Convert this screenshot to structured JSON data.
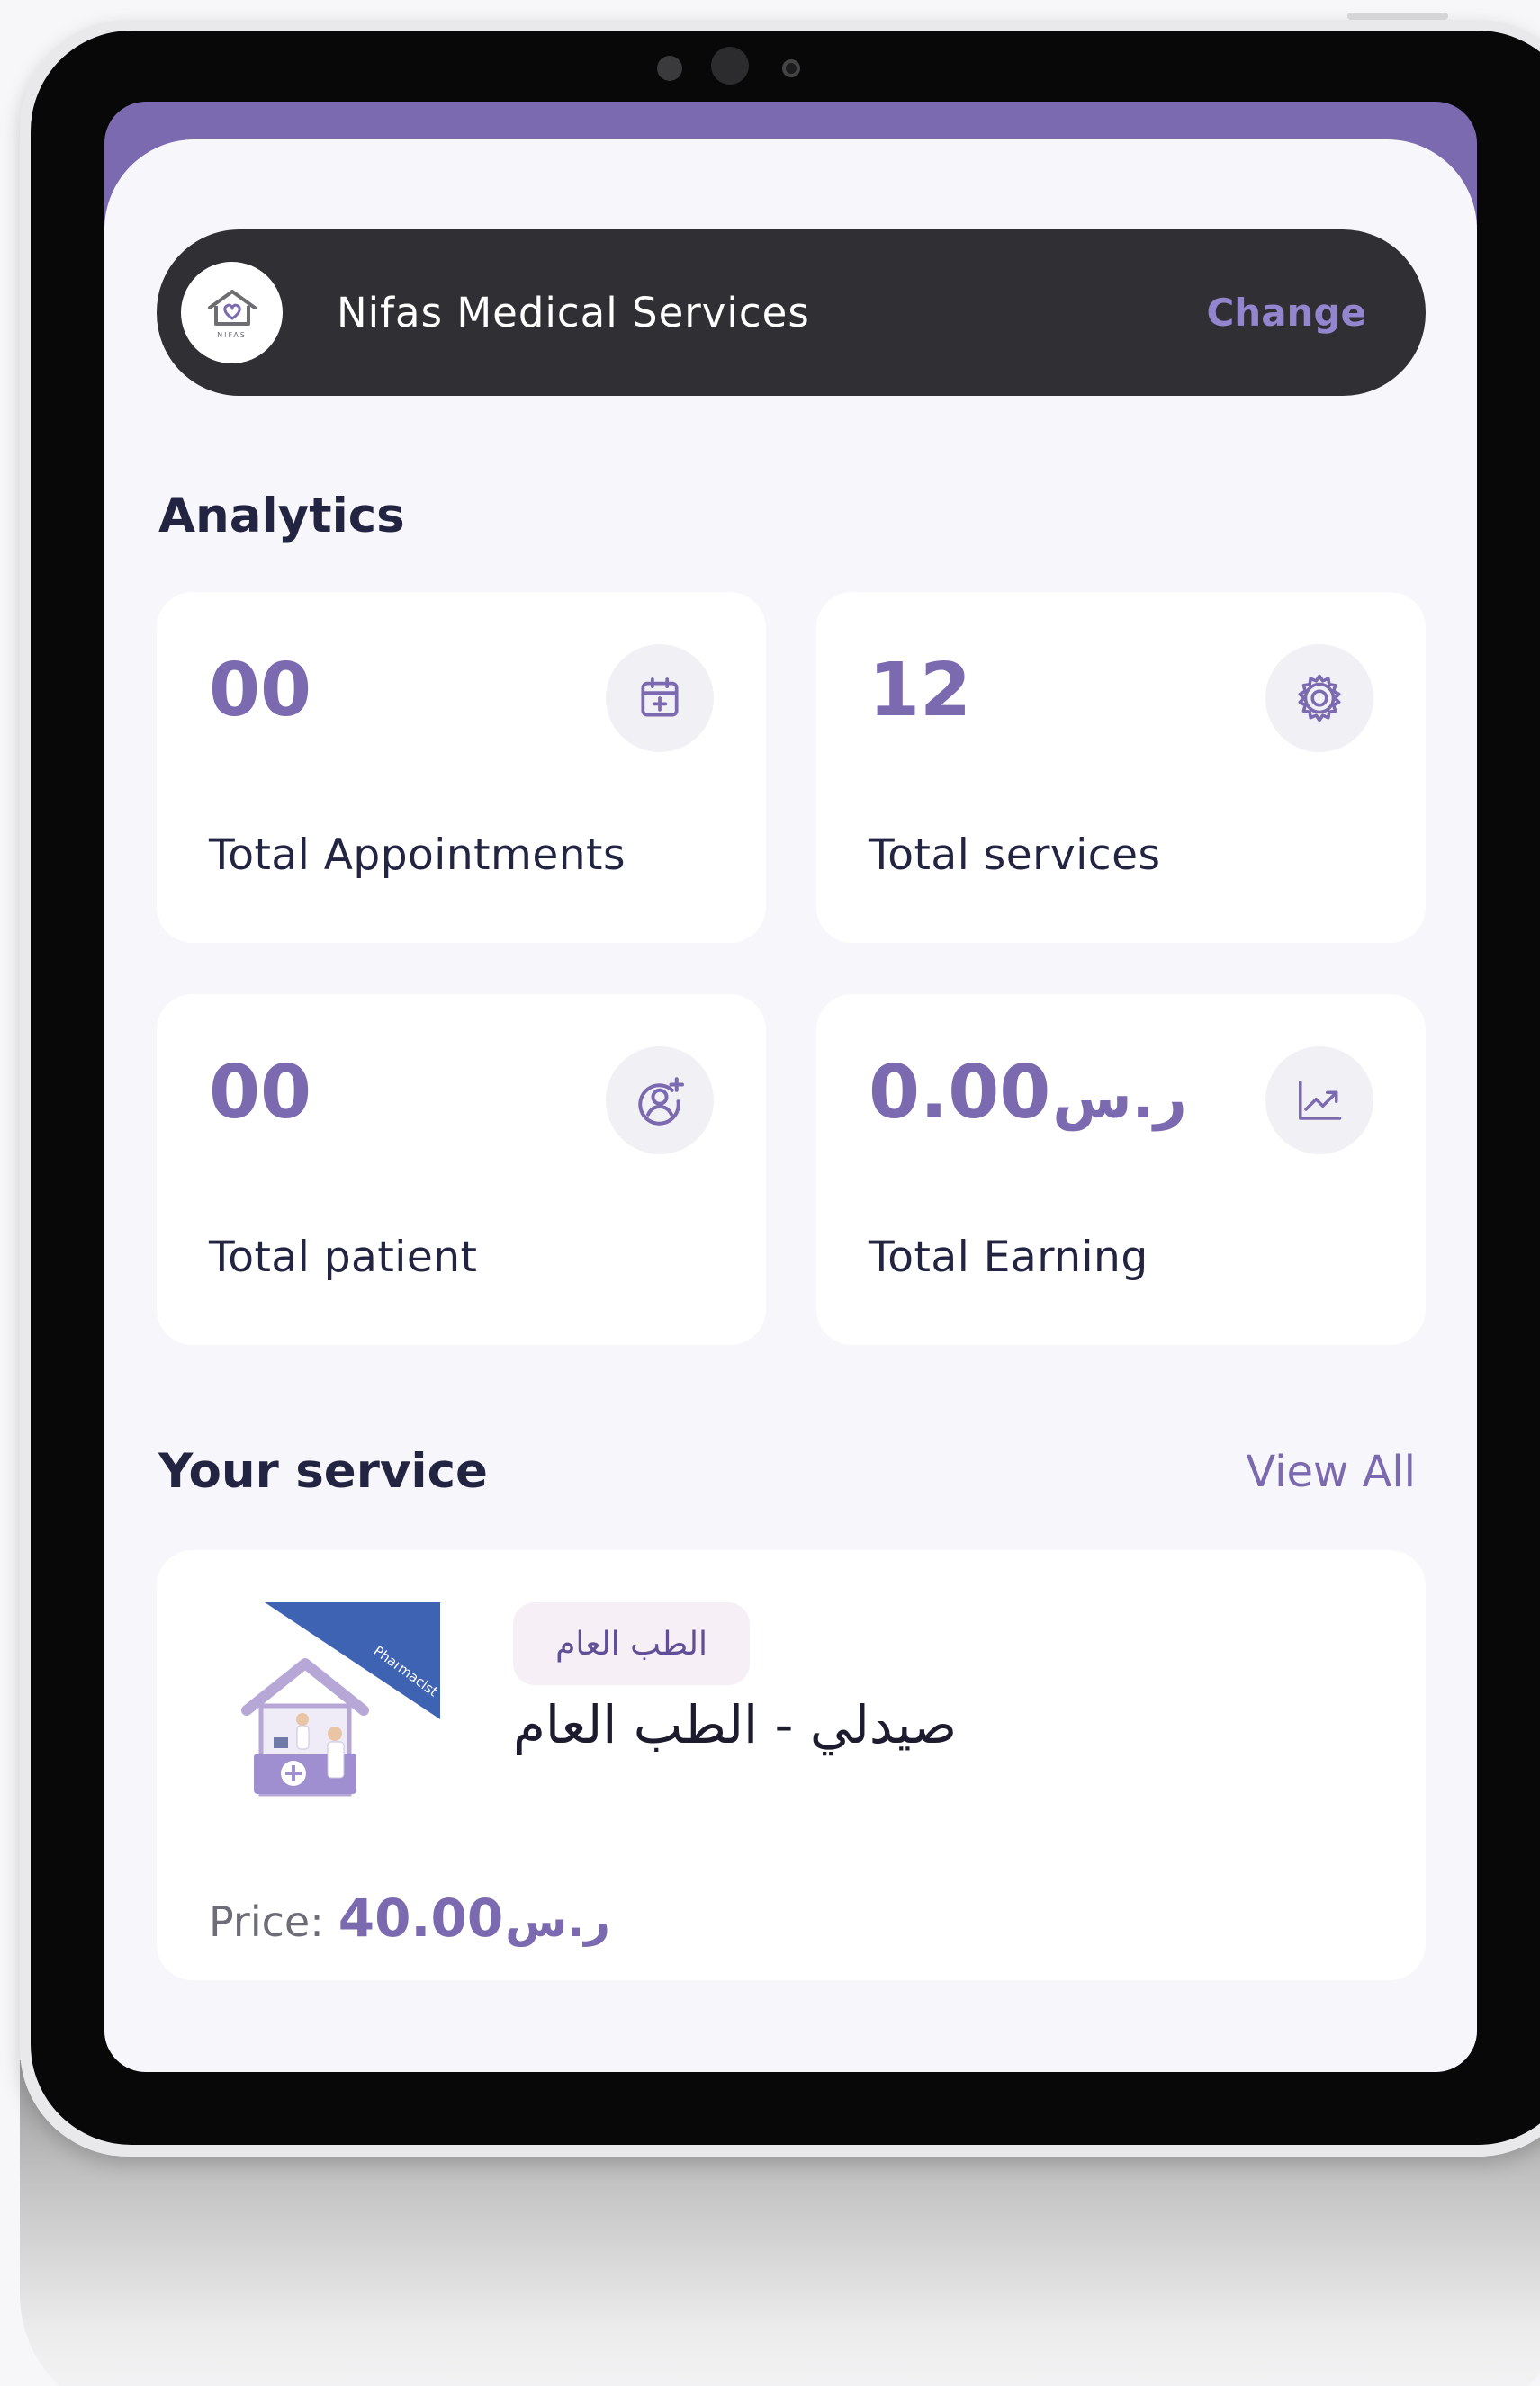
{
  "header": {
    "clinic_name": "Nifas Medical Services",
    "change_label": "Change",
    "logo_text": "NIFAS"
  },
  "analytics": {
    "title": "Analytics",
    "cards": [
      {
        "value": "00",
        "label": "Total Appointments",
        "icon": "calendar-add-icon"
      },
      {
        "value": "12",
        "label": "Total services",
        "icon": "settings-icon"
      },
      {
        "value": "00",
        "label": "Total patient",
        "icon": "user-add-icon"
      },
      {
        "value": "0.00",
        "currency": "ر.س",
        "label": "Total Earning",
        "icon": "trending-up-icon"
      }
    ]
  },
  "services": {
    "title": "Your service",
    "view_all_label": "View All",
    "items": [
      {
        "category": "الطب العام",
        "name": "صيدلي - الطب العام",
        "image_badge": "Pharmacist",
        "price_label": "Price:",
        "price_value": "40.00",
        "currency": "ر.س"
      }
    ]
  },
  "colors": {
    "accent": "#7c6ab0",
    "header_bg": "#303034",
    "page_bg": "#f7f7fb",
    "text_dark": "#232342"
  }
}
